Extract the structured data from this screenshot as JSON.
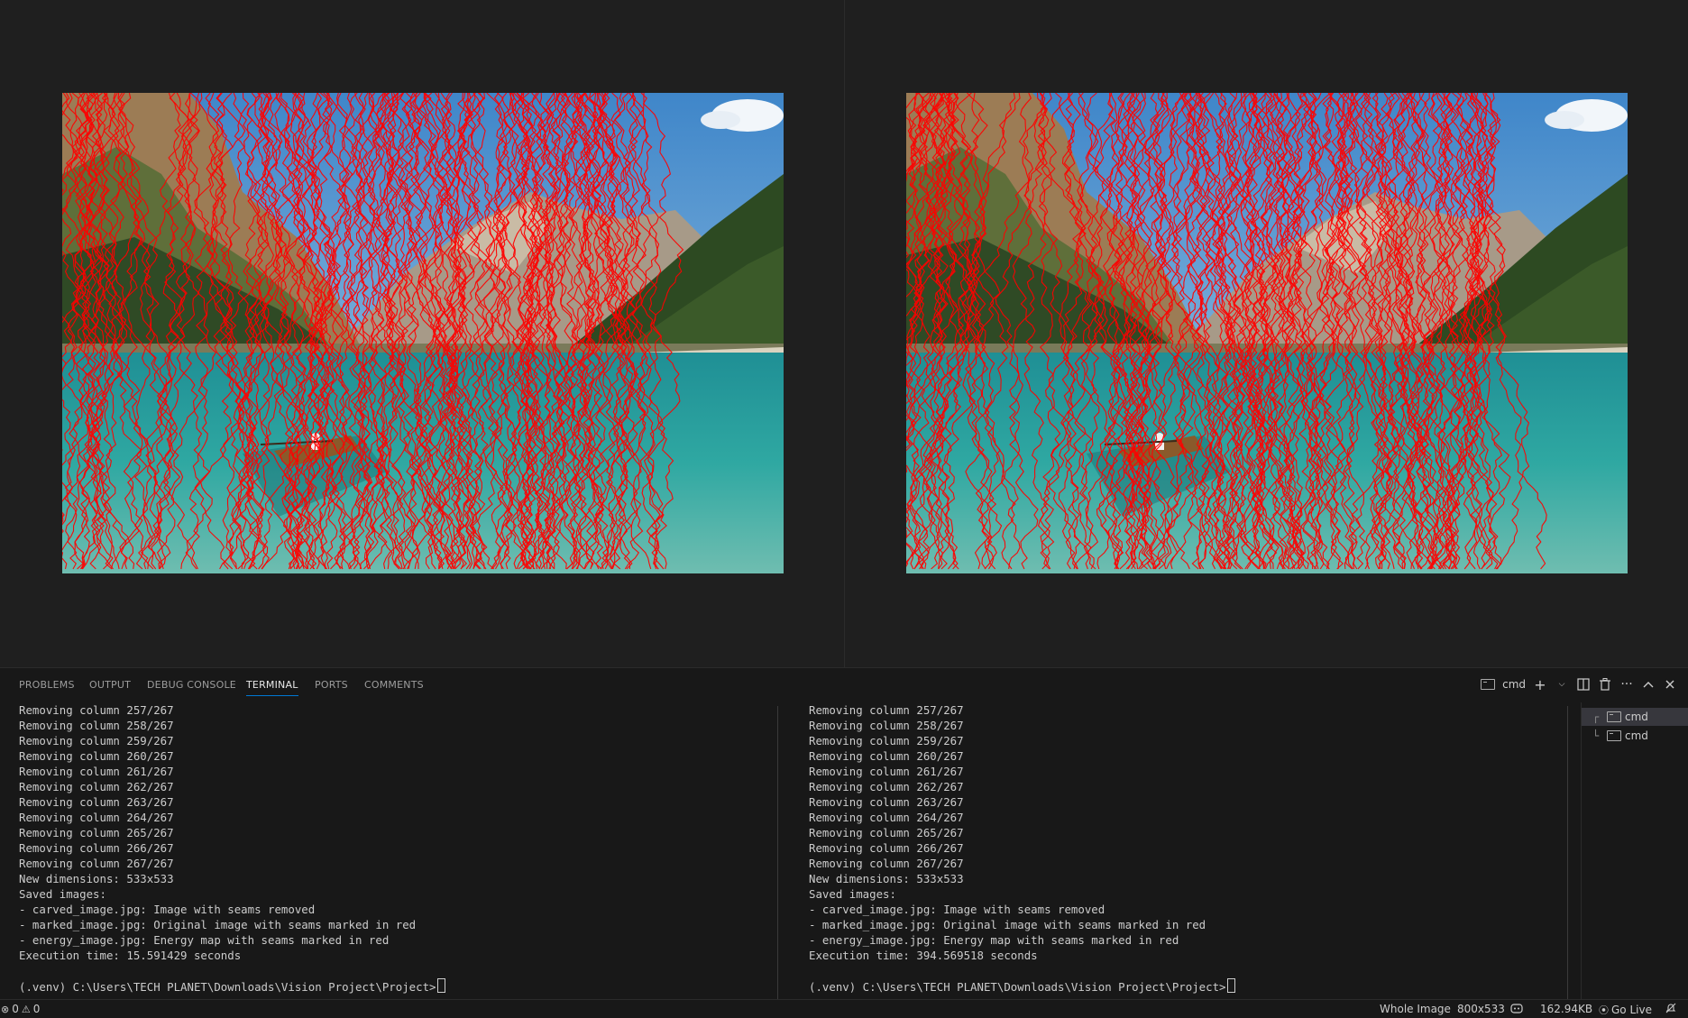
{
  "panel": {
    "tabs": [
      {
        "label": "PROBLEMS"
      },
      {
        "label": "OUTPUT"
      },
      {
        "label": "DEBUG CONSOLE"
      },
      {
        "label": "TERMINAL"
      },
      {
        "label": "PORTS"
      },
      {
        "label": "COMMENTS"
      }
    ],
    "active_tab": "TERMINAL",
    "actions": {
      "terminal_label": "cmd"
    }
  },
  "terminals": {
    "left": {
      "lines": [
        "Removing column 257/267",
        "Removing column 258/267",
        "Removing column 259/267",
        "Removing column 260/267",
        "Removing column 261/267",
        "Removing column 262/267",
        "Removing column 263/267",
        "Removing column 264/267",
        "Removing column 265/267",
        "Removing column 266/267",
        "Removing column 267/267",
        "New dimensions: 533x533",
        "Saved images:",
        "- carved_image.jpg: Image with seams removed",
        "- marked_image.jpg: Original image with seams marked in red",
        "- energy_image.jpg: Energy map with seams marked in red",
        "Execution time: 15.591429 seconds",
        ""
      ],
      "prompt": "(.venv) C:\\Users\\TECH PLANET\\Downloads\\Vision Project\\Project>"
    },
    "right": {
      "lines": [
        "Removing column 257/267",
        "Removing column 258/267",
        "Removing column 259/267",
        "Removing column 260/267",
        "Removing column 261/267",
        "Removing column 262/267",
        "Removing column 263/267",
        "Removing column 264/267",
        "Removing column 265/267",
        "Removing column 266/267",
        "Removing column 267/267",
        "New dimensions: 533x533",
        "Saved images:",
        "- carved_image.jpg: Image with seams removed",
        "- marked_image.jpg: Original image with seams marked in red",
        "- energy_image.jpg: Energy map with seams marked in red",
        "Execution time: 394.569518 seconds",
        ""
      ],
      "prompt": "(.venv) C:\\Users\\TECH PLANET\\Downloads\\Vision Project\\Project>"
    }
  },
  "terminal_list": [
    {
      "label": "cmd",
      "selected": true
    },
    {
      "label": "cmd",
      "selected": false
    }
  ],
  "statusbar": {
    "errors": "0",
    "warnings": "0",
    "zoom_mode": "Whole Image",
    "dimensions": "800x533",
    "file_size": "162.94KB",
    "go_live": "Go Live"
  },
  "colors": {
    "seam": "#ff0000",
    "accent": "#0078d4",
    "background": "#1f1f1f",
    "panel": "#181818"
  }
}
